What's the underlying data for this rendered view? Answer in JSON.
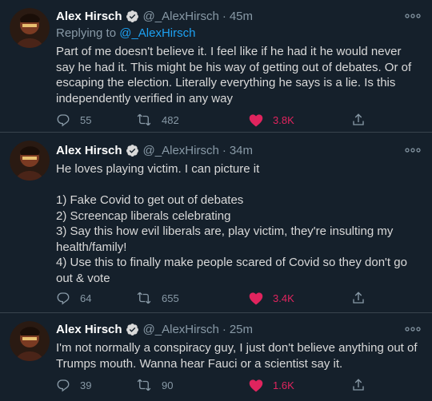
{
  "tweets": [
    {
      "name": "Alex Hirsch",
      "handle": "@_AlexHirsch",
      "time": "45m",
      "reply_prefix": "Replying to ",
      "reply_handle": "@_AlexHirsch",
      "text": "Part of me doesn't believe it. I feel like if he had it he would never say he had it. This might be his way of getting out of debates. Or of escaping the election. Literally everything he says is a lie. Is this independently verified in any way",
      "replies": "55",
      "retweets": "482",
      "likes": "3.8K"
    },
    {
      "name": "Alex Hirsch",
      "handle": "@_AlexHirsch",
      "time": "34m",
      "text": "He loves playing victim. I can picture it\n\n1) Fake Covid to get out of debates\n2) Screencap liberals celebrating\n3) Say this how evil liberals are, play victim, they're insulting my health/family!\n4) Use this to finally make people scared of Covid so they don't go out & vote",
      "replies": "64",
      "retweets": "655",
      "likes": "3.4K"
    },
    {
      "name": "Alex Hirsch",
      "handle": "@_AlexHirsch",
      "time": "25m",
      "text": "I'm not normally a conspiracy guy, I just don't believe anything out of Trumps mouth. Wanna hear Fauci or a scientist say it.",
      "replies": "39",
      "retweets": "90",
      "likes": "1.6K"
    }
  ],
  "separator": "·",
  "icons": {
    "verified": "verified-badge-icon",
    "more": "more-options-icon",
    "reply": "reply-icon",
    "retweet": "retweet-icon",
    "like": "heart-icon",
    "share": "share-icon"
  },
  "colors": {
    "background": "#15202b",
    "text": "#d9d9d9",
    "secondary": "#8899a6",
    "link": "#1da1f2",
    "like": "#e0245e",
    "divider": "#38444d"
  }
}
